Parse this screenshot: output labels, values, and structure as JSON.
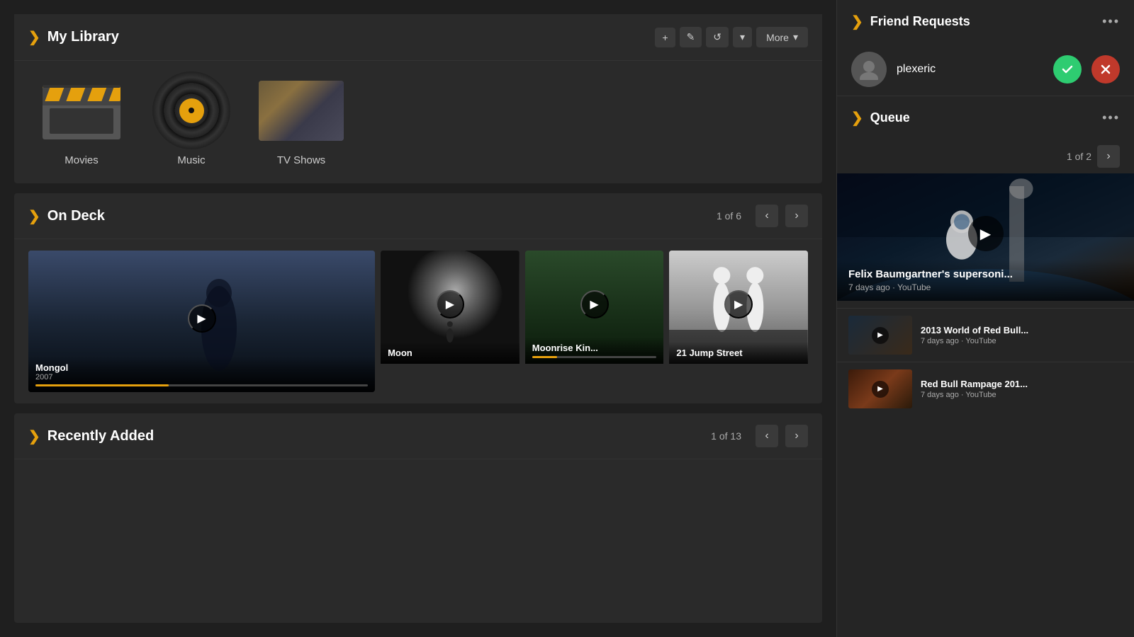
{
  "myLibrary": {
    "title": "My Library",
    "items": [
      {
        "id": "movies",
        "label": "Movies"
      },
      {
        "id": "music",
        "label": "Music"
      },
      {
        "id": "tvshows",
        "label": "TV Shows"
      }
    ],
    "toolbar": {
      "add": "+",
      "edit": "✎",
      "refresh": "↺",
      "dropdown": "▾",
      "more": "More",
      "moreArrow": "▾"
    }
  },
  "onDeck": {
    "title": "On Deck",
    "page": "1",
    "totalPages": "6",
    "cards": [
      {
        "id": "mongol",
        "title": "Mongol",
        "subtitle": "2007",
        "progress": 40
      },
      {
        "id": "moon",
        "title": "Moon",
        "subtitle": ""
      },
      {
        "id": "moonrise",
        "title": "Moonrise Kin...",
        "subtitle": ""
      },
      {
        "id": "jumpstreet",
        "title": "21 Jump Street",
        "subtitle": ""
      }
    ]
  },
  "recentlyAdded": {
    "title": "Recently Added",
    "page": "1",
    "totalPages": "13"
  },
  "friendRequests": {
    "title": "Friend Requests",
    "friends": [
      {
        "id": "plexeric",
        "name": "plexeric"
      }
    ]
  },
  "queue": {
    "title": "Queue",
    "page": "1",
    "totalPages": "2",
    "featured": {
      "title": "Felix Baumgartner's supersoni...",
      "meta": "7 days ago · YouTube"
    },
    "items": [
      {
        "id": "redbull2013",
        "title": "2013 World of Red Bull...",
        "meta": "7 days ago · YouTube"
      },
      {
        "id": "rampage",
        "title": "Red Bull Rampage 201...",
        "meta": "7 days ago · YouTube"
      }
    ]
  }
}
